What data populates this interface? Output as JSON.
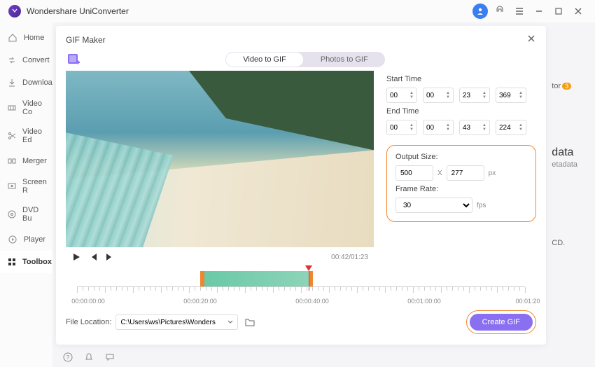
{
  "app": {
    "title": "Wondershare UniConverter"
  },
  "sidebar": {
    "items": [
      {
        "label": "Home",
        "icon": "home"
      },
      {
        "label": "Convert",
        "icon": "convert"
      },
      {
        "label": "Downloa",
        "icon": "download"
      },
      {
        "label": "Video Co",
        "icon": "compress"
      },
      {
        "label": "Video Ed",
        "icon": "scissors"
      },
      {
        "label": "Merger",
        "icon": "merge"
      },
      {
        "label": "Screen R",
        "icon": "record"
      },
      {
        "label": "DVD Bu",
        "icon": "dvd"
      },
      {
        "label": "Player",
        "icon": "play"
      },
      {
        "label": "Toolbox",
        "icon": "grid"
      }
    ]
  },
  "behind": {
    "tor": "tor",
    "badge": "3",
    "data": "data",
    "etadata": "etadata",
    "cd": "CD."
  },
  "modal": {
    "title": "GIF Maker",
    "tabs": {
      "video": "Video to GIF",
      "photos": "Photos to GIF"
    },
    "time": {
      "start_label": "Start Time",
      "end_label": "End Time",
      "start": {
        "h": "00",
        "m": "00",
        "s": "23",
        "ms": "369"
      },
      "end": {
        "h": "00",
        "m": "00",
        "s": "43",
        "ms": "224"
      }
    },
    "output": {
      "size_label": "Output Size:",
      "w": "500",
      "x": "X",
      "h": "277",
      "px": "px",
      "rate_label": "Frame Rate:",
      "rate": "30",
      "fps": "fps"
    },
    "playback": {
      "current": "00:42",
      "total": "01:23"
    },
    "timeline": {
      "labels": [
        "00:00:00:00",
        "00:00:20:00",
        "00:00:40:00",
        "00:01:00:00",
        "00:01:20"
      ]
    },
    "file": {
      "label": "File Location:",
      "path": "C:\\Users\\ws\\Pictures\\Wonders"
    },
    "create": "Create GIF"
  }
}
